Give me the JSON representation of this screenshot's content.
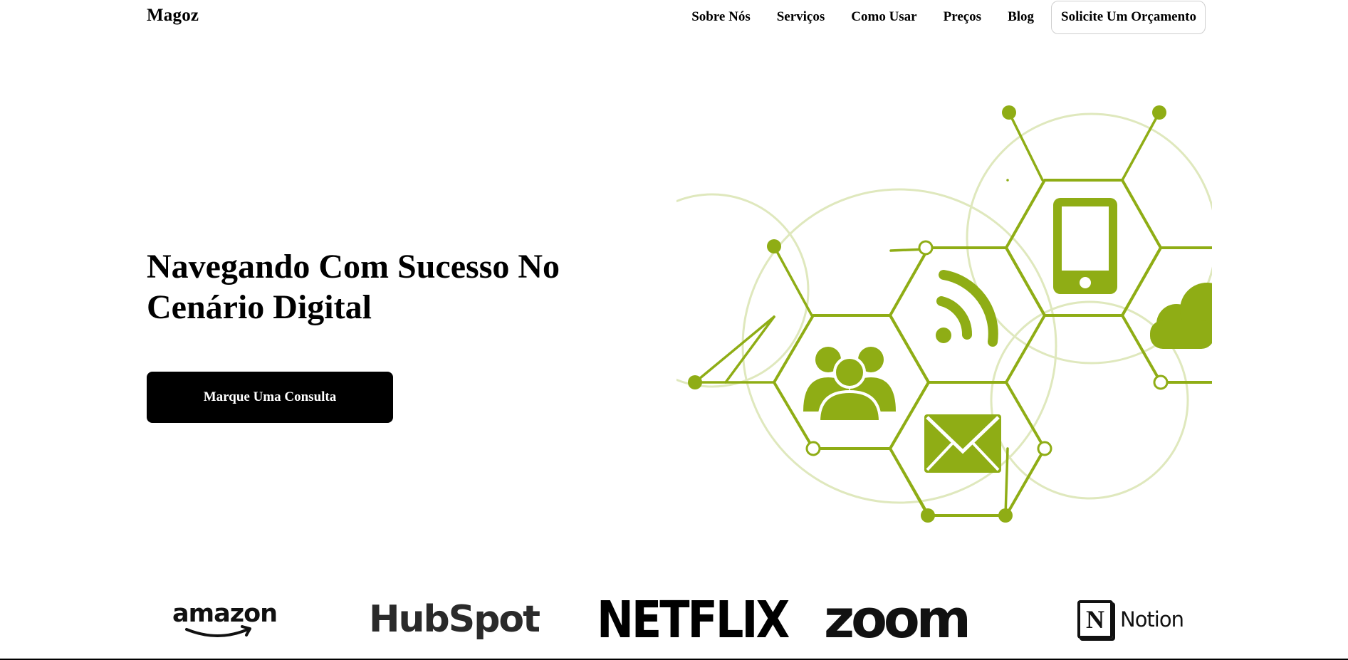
{
  "header": {
    "brand": "Magoz",
    "nav": [
      "Sobre Nós",
      "Serviços",
      "Como Usar",
      "Preços",
      "Blog"
    ],
    "cta": "Solicite Um Orçamento"
  },
  "hero": {
    "title": "Navegando Com Sucesso No Cenário Digital",
    "button": "Marque Uma Consulta",
    "illustration": {
      "accent_color": "#8fad15",
      "icons": [
        "people-icon",
        "rss-icon",
        "smartphone-icon",
        "envelope-icon",
        "cloud-icon"
      ]
    }
  },
  "logos": {
    "amazon": "amazon",
    "hubspot": "HubSpot",
    "netflix": "NETFLIX",
    "zoom": "zoom",
    "notion": "Notion",
    "notion_mark": "N"
  }
}
